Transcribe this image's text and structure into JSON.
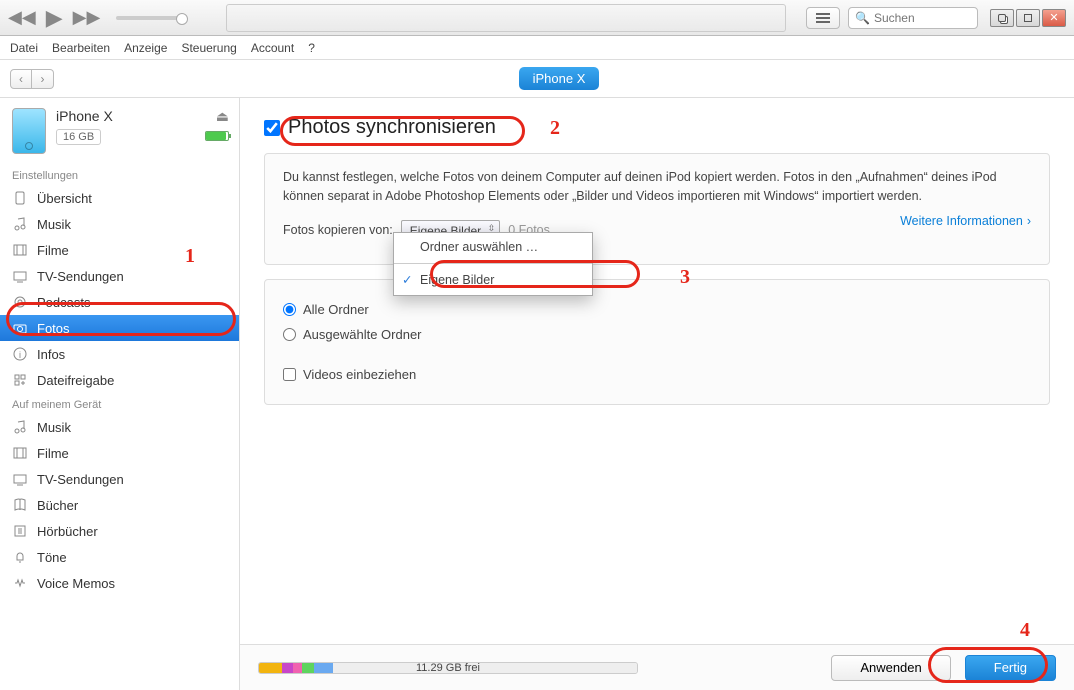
{
  "menu": {
    "items": [
      "Datei",
      "Bearbeiten",
      "Anzeige",
      "Steuerung",
      "Account",
      "?"
    ]
  },
  "search": {
    "placeholder": "Suchen"
  },
  "device_badge": "iPhone X",
  "device": {
    "name": "iPhone X",
    "capacity": "16 GB",
    "battery_pct": 92
  },
  "sidebar": {
    "section_settings": "Einstellungen",
    "section_ondevice": "Auf meinem Gerät",
    "settings": [
      {
        "key": "uebersicht",
        "label": "Übersicht",
        "icon": "device"
      },
      {
        "key": "musik",
        "label": "Musik",
        "icon": "music"
      },
      {
        "key": "filme",
        "label": "Filme",
        "icon": "film"
      },
      {
        "key": "tv",
        "label": "TV-Sendungen",
        "icon": "tv"
      },
      {
        "key": "podcasts",
        "label": "Podcasts",
        "icon": "podcast"
      },
      {
        "key": "fotos",
        "label": "Fotos",
        "icon": "camera",
        "active": true
      },
      {
        "key": "infos",
        "label": "Infos",
        "icon": "info"
      },
      {
        "key": "datei",
        "label": "Dateifreigabe",
        "icon": "apps"
      }
    ],
    "ondevice": [
      {
        "key": "d-musik",
        "label": "Musik",
        "icon": "music"
      },
      {
        "key": "d-filme",
        "label": "Filme",
        "icon": "film"
      },
      {
        "key": "d-tv",
        "label": "TV-Sendungen",
        "icon": "tv"
      },
      {
        "key": "d-buecher",
        "label": "Bücher",
        "icon": "book"
      },
      {
        "key": "d-hoer",
        "label": "Hörbücher",
        "icon": "audiobook"
      },
      {
        "key": "d-toene",
        "label": "Töne",
        "icon": "bell"
      },
      {
        "key": "d-voice",
        "label": "Voice Memos",
        "icon": "voice"
      }
    ]
  },
  "main": {
    "sync_title": "Photos synchronisieren",
    "desc": "Du kannst festlegen, welche Fotos von deinem Computer auf deinen iPod kopiert werden. Fotos in den „Aufnahmen“ deines iPod können separat in Adobe Photoshop Elements oder „Bilder und Videos importieren mit Windows“ importiert werden.",
    "copy_from_label": "Fotos kopieren von:",
    "dd_value": "Eigene Bilder",
    "dd_count": "0 Fotos",
    "dd_opt_choose": "Ordner auswählen …",
    "dd_opt_own": "Eigene Bilder",
    "more_info": "Weitere Informationen",
    "radio_all": "Alle Ordner",
    "radio_selected": "Ausgewählte Ordner",
    "check_videos": "Videos einbeziehen"
  },
  "bottom": {
    "free_text": "11.29 GB frei",
    "apply": "Anwenden",
    "done": "Fertig"
  },
  "annotations": {
    "n1": "1",
    "n2": "2",
    "n3": "3",
    "n4": "4"
  }
}
